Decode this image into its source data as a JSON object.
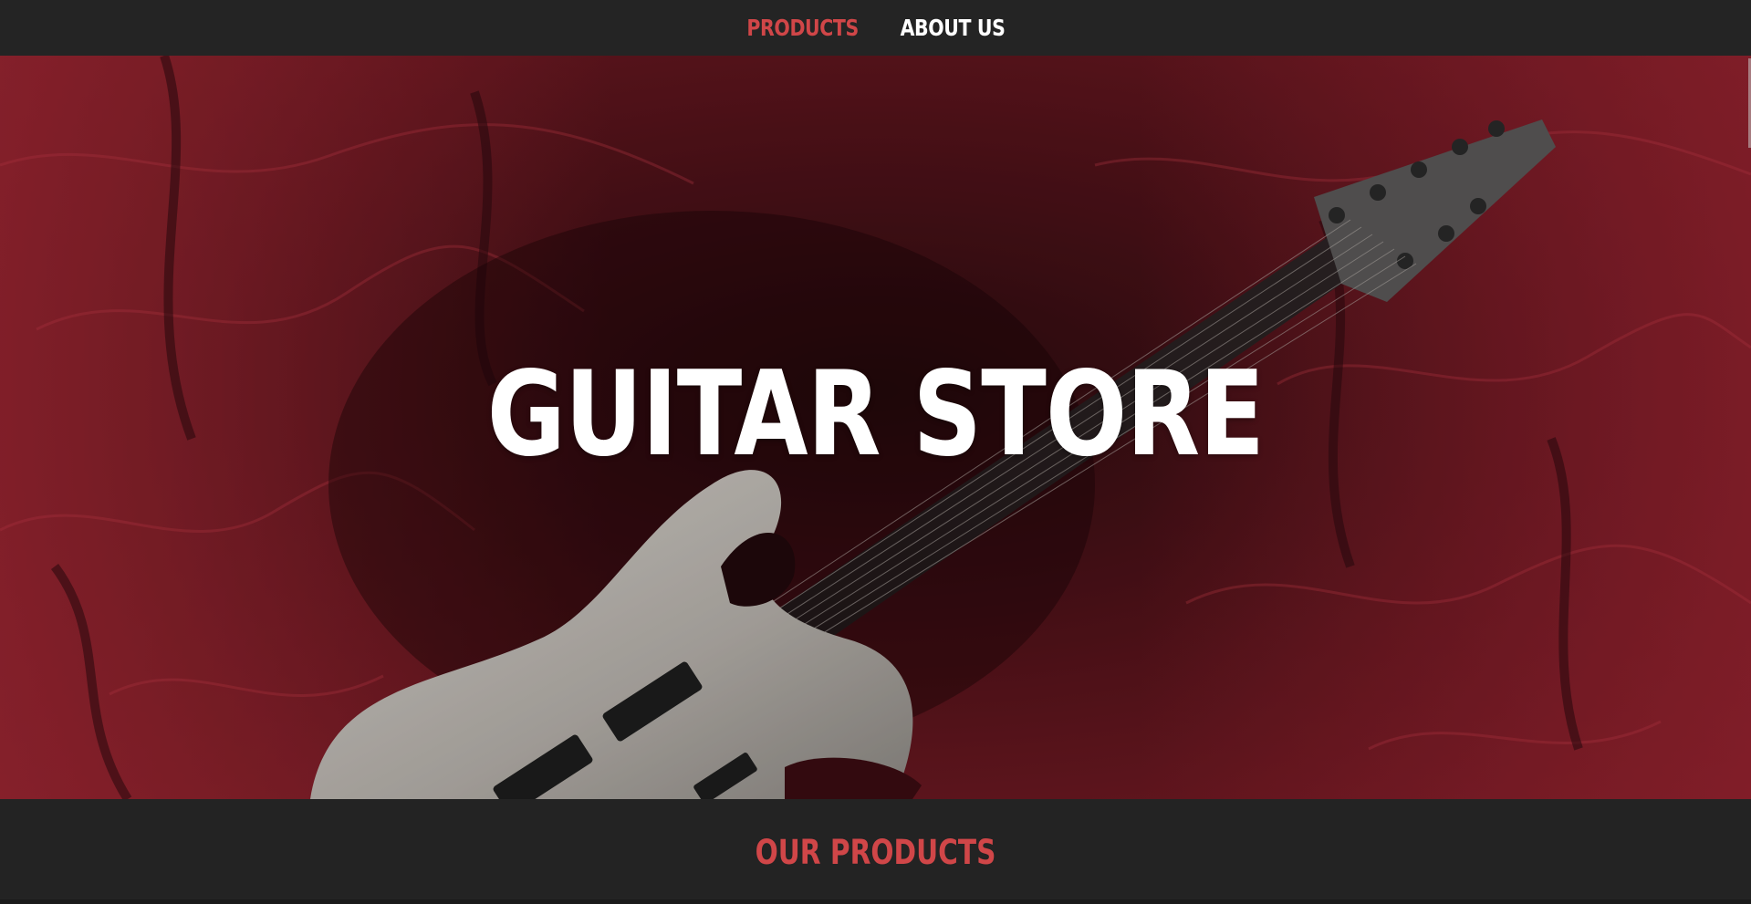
{
  "nav": {
    "items": [
      {
        "label": "PRODUCTS",
        "active": true
      },
      {
        "label": "ABOUT US",
        "active": false
      }
    ]
  },
  "hero": {
    "title": "GUITAR STORE",
    "background_icon": "guitar-on-red-fabric-photo"
  },
  "products_section": {
    "title": "OUR PRODUCTS"
  },
  "colors": {
    "accent": "#d04648",
    "nav_bg": "#242424",
    "page_bg": "#232323",
    "hero_title": "#ffffff",
    "fabric": "#8e1f2a"
  }
}
